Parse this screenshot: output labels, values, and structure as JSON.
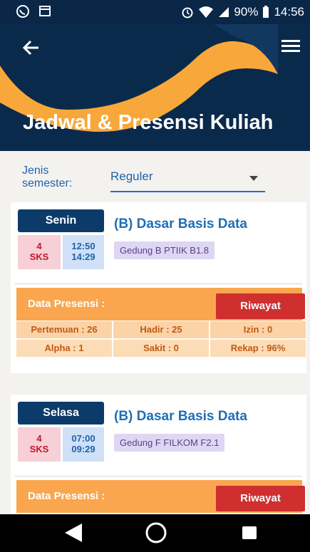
{
  "status_bar": {
    "battery": "90%",
    "time": "14:56"
  },
  "header": {
    "title": "Jadwal & Presensi Kuliah"
  },
  "semester": {
    "label": "Jenis semester:",
    "selected": "Reguler"
  },
  "schedule": [
    {
      "day": "Senin",
      "sks_number": "4",
      "sks_label": "SKS",
      "start": "12:50",
      "end": "14:29",
      "course": "(B) Dasar Basis Data",
      "room": "Gedung B PTIIK B1.8",
      "presensi_title": "Data Presensi :",
      "riwayat_label": "Riwayat",
      "stats": {
        "pertemuan": "Pertemuan : 26",
        "hadir": "Hadir : 25",
        "izin": "Izin : 0",
        "alpha": "Alpha : 1",
        "sakit": "Sakit : 0",
        "rekap": "Rekap : 96%"
      }
    },
    {
      "day": "Selasa",
      "sks_number": "4",
      "sks_label": "SKS",
      "start": "07:00",
      "end": "09:29",
      "course": "(B) Dasar Basis Data",
      "room": "Gedung F FILKOM F2.1",
      "presensi_title": "Data Presensi :",
      "riwayat_label": "Riwayat"
    }
  ],
  "colors": {
    "primary": "#0a2a4b",
    "accent": "#f9a64f",
    "danger": "#cf2f2f",
    "link": "#1e6fb5"
  },
  "icons": {
    "whatsapp": "whatsapp-icon",
    "calendar": "calendar-icon",
    "alarm": "alarm-icon",
    "wifi": "wifi-icon",
    "signal": "signal-icon",
    "battery": "battery-icon",
    "back": "back-arrow-icon",
    "menu": "hamburger-menu-icon"
  }
}
